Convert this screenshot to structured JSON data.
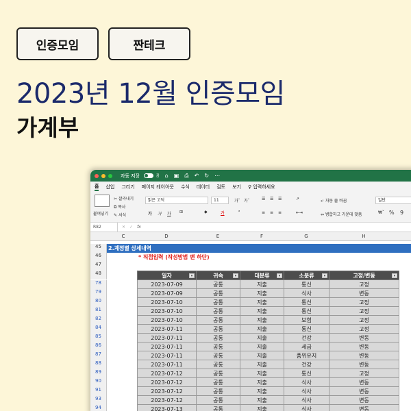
{
  "tags": [
    "인증모임",
    "짠테크"
  ],
  "title_line1": "2023년 12월 인증모임",
  "title_line2": "가계부",
  "excel": {
    "autosave_label": "자동 저장",
    "autosave_state": "끔",
    "menu": [
      "홈",
      "삽입",
      "그리기",
      "페이지 레이아웃",
      "수식",
      "데이터",
      "검토",
      "보기",
      "입력하세요"
    ],
    "ribbon": {
      "paste": "붙여넣기",
      "cut": "잘라내기",
      "copy": "복사",
      "format": "서식",
      "font": "맑은 고딕",
      "font_size": "11",
      "wrap": "자동 줄 바꿈",
      "merge": "병합하고 가운데 맞춤",
      "number_format": "일반"
    },
    "name_box": "R82",
    "fx": "fx",
    "columns": [
      "C",
      "D",
      "E",
      "F",
      "G",
      "H"
    ],
    "top_rows": [
      "45",
      "46",
      "47",
      "48"
    ],
    "section_title": "2.계정별 상세내역",
    "note": "* 직접입력 (작성방법 맨 하단)",
    "headers": [
      "일자",
      "귀속",
      "대분류",
      "소분류",
      "고정/변동"
    ],
    "rows": [
      {
        "n": "78",
        "d": "2023-07-09",
        "a": "공통",
        "b": "지출",
        "c": "통신",
        "e": "고정"
      },
      {
        "n": "79",
        "d": "2023-07-09",
        "a": "공통",
        "b": "지출",
        "c": "식사",
        "e": "변동"
      },
      {
        "n": "80",
        "d": "2023-07-10",
        "a": "공통",
        "b": "지출",
        "c": "통신",
        "e": "고정"
      },
      {
        "n": "81",
        "d": "2023-07-10",
        "a": "공통",
        "b": "지출",
        "c": "통신",
        "e": "고정"
      },
      {
        "n": "82",
        "d": "2023-07-10",
        "a": "공통",
        "b": "지출",
        "c": "보험",
        "e": "고정"
      },
      {
        "n": "84",
        "d": "2023-07-11",
        "a": "공통",
        "b": "지출",
        "c": "통신",
        "e": "고정"
      },
      {
        "n": "85",
        "d": "2023-07-11",
        "a": "공통",
        "b": "지출",
        "c": "건강",
        "e": "변동"
      },
      {
        "n": "86",
        "d": "2023-07-11",
        "a": "공통",
        "b": "지출",
        "c": "세금",
        "e": "변동"
      },
      {
        "n": "87",
        "d": "2023-07-11",
        "a": "공통",
        "b": "지출",
        "c": "품위유지",
        "e": "변동"
      },
      {
        "n": "88",
        "d": "2023-07-11",
        "a": "공통",
        "b": "지출",
        "c": "건강",
        "e": "변동"
      },
      {
        "n": "89",
        "d": "2023-07-12",
        "a": "공통",
        "b": "지출",
        "c": "통신",
        "e": "고정"
      },
      {
        "n": "90",
        "d": "2023-07-12",
        "a": "공통",
        "b": "지출",
        "c": "식사",
        "e": "변동"
      },
      {
        "n": "91",
        "d": "2023-07-12",
        "a": "공통",
        "b": "지출",
        "c": "식사",
        "e": "변동"
      },
      {
        "n": "93",
        "d": "2023-07-12",
        "a": "공통",
        "b": "지출",
        "c": "식사",
        "e": "변동"
      },
      {
        "n": "94",
        "d": "2023-07-13",
        "a": "공통",
        "b": "지출",
        "c": "식사",
        "e": "변동"
      }
    ]
  }
}
